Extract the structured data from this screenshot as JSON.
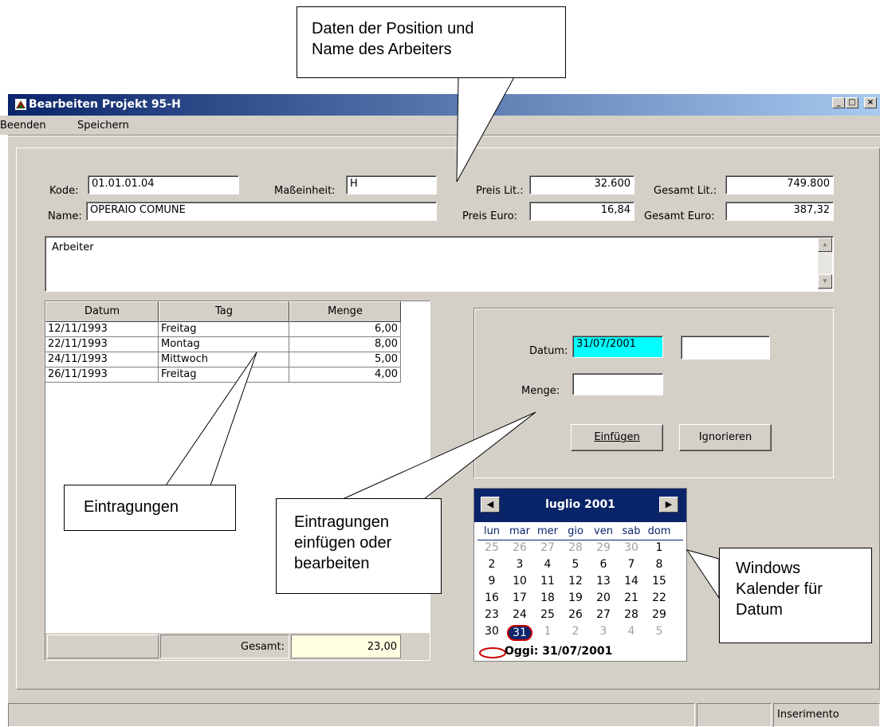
{
  "window": {
    "title": "Bearbeiten Projekt 95-H"
  },
  "menu": {
    "beenden": "Beenden",
    "speichern": "Speichern"
  },
  "form": {
    "kode_label": "Kode:",
    "kode_value": "01.01.01.04",
    "name_label": "Name:",
    "name_value": "OPERAIO COMUNE",
    "unit_label": "Maßeinheit:",
    "unit_value": "H",
    "preis_lit_label": "Preis Lit.:",
    "preis_lit_value": "32.600",
    "preis_euro_label": "Preis Euro:",
    "preis_euro_value": "16,84",
    "gesamt_lit_label": "Gesamt Lit.:",
    "gesamt_lit_value": "749.800",
    "gesamt_euro_label": "Gesamt Euro:",
    "gesamt_euro_value": "387,32",
    "description": "Arbeiter"
  },
  "grid": {
    "headers": [
      "Datum",
      "Tag",
      "Menge"
    ],
    "rows": [
      [
        "12/11/1993",
        "Freitag",
        "6,00"
      ],
      [
        "22/11/1993",
        "Montag",
        "8,00"
      ],
      [
        "24/11/1993",
        "Mittwoch",
        "5,00"
      ],
      [
        "26/11/1993",
        "Freitag",
        "4,00"
      ]
    ],
    "total_label": "Gesamt:",
    "total_value": "23,00"
  },
  "entry": {
    "datum_label": "Datum:",
    "datum_value": "31/07/2001",
    "menge_label": "Menge:",
    "menge_value": "",
    "insert_button": "Einfügen",
    "ignore_button": "Ignorieren"
  },
  "calendar": {
    "month_title": "luglio 2001",
    "weekdays": [
      "lun",
      "mar",
      "mer",
      "gio",
      "ven",
      "sab",
      "dom"
    ],
    "weeks": [
      [
        "25",
        "26",
        "27",
        "28",
        "29",
        "30",
        "1"
      ],
      [
        "2",
        "3",
        "4",
        "5",
        "6",
        "7",
        "8"
      ],
      [
        "9",
        "10",
        "11",
        "12",
        "13",
        "14",
        "15"
      ],
      [
        "16",
        "17",
        "18",
        "19",
        "20",
        "21",
        "22"
      ],
      [
        "23",
        "24",
        "25",
        "26",
        "27",
        "28",
        "29"
      ],
      [
        "30",
        "31",
        "1",
        "2",
        "3",
        "4",
        "5"
      ]
    ],
    "today_label": "Oggi: 31/07/2001"
  },
  "status": {
    "mode": "Inserimento"
  },
  "callouts": {
    "top_line1": "Daten der Position und",
    "top_line2": "Name des Arbeiters",
    "entries": "Eintragungen",
    "edit_line1": "Eintragungen",
    "edit_line2": "einfügen oder",
    "edit_line3": "bearbeiten",
    "cal_line1": "Windows",
    "cal_line2": "Kalender für",
    "cal_line3": "Datum"
  },
  "colors": {
    "title_bar": "#0a246a",
    "date_field_bg": "#00ffff",
    "total_bg": "#ffffe1",
    "today_circle": "#cc0000"
  }
}
